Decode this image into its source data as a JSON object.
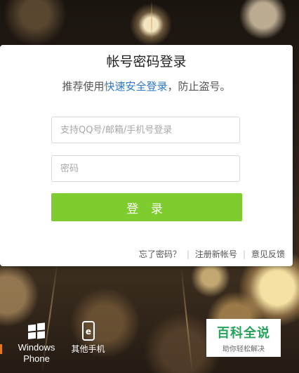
{
  "login": {
    "title": "帐号密码登录",
    "subtitle_prefix": "推荐使用",
    "subtitle_link": "快速安全登录",
    "subtitle_suffix": "，防止盗号。",
    "account_placeholder": "支持QQ号/邮箱/手机号登录",
    "password_placeholder": "密码",
    "login_button": "登 录",
    "links": {
      "forgot": "忘了密码？",
      "register": "注册新帐号",
      "feedback": "意见反馈"
    },
    "separator": "|"
  },
  "bottom": {
    "windows_phone_line1": "Windows",
    "windows_phone_line2": "Phone",
    "other_phones": "其他手机"
  },
  "watermark": {
    "title": "百科全说",
    "subtitle": "助你轻松解决"
  },
  "colors": {
    "accent_green": "#7fcc2f",
    "link_blue": "#2d78c8"
  }
}
